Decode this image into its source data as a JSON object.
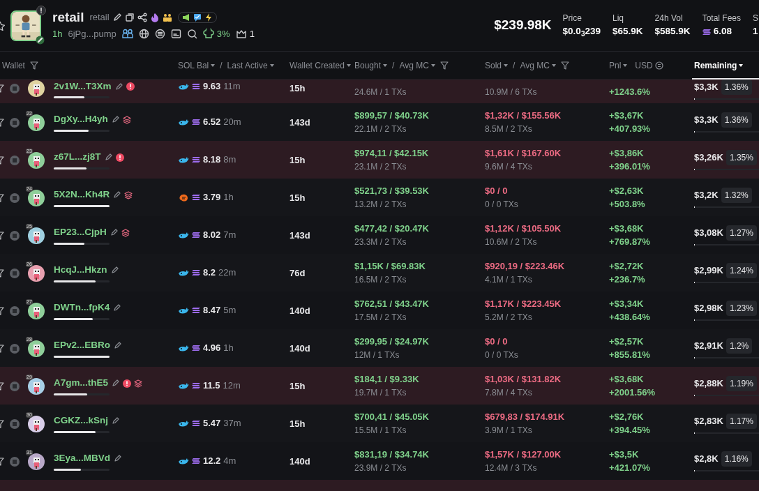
{
  "token": {
    "name": "retail",
    "ticker": "retail",
    "age": "1h",
    "address": "6jPg...pump",
    "chef_pct": "3%",
    "crown_count": "1"
  },
  "market_cap": "$239.98K",
  "stats": [
    {
      "label": "Price",
      "value": "$0.0$_{3}$239",
      "kind": "plain"
    },
    {
      "label": "Liq",
      "value": "$65.9K",
      "kind": "plain"
    },
    {
      "label": "24h Vol",
      "value": "$585.9K",
      "kind": "plain"
    },
    {
      "label": "Total Fees",
      "value": "6.08",
      "kind": "sol"
    },
    {
      "label": "S",
      "value": "1",
      "kind": "plain"
    }
  ],
  "columns": [
    {
      "labels": [
        {
          "text": "Wallet",
          "sortable": false
        }
      ],
      "filter": true,
      "selected": false
    },
    {
      "labels": [
        {
          "text": "SOL Bal",
          "sortable": true
        },
        {
          "text": "Last Active",
          "sortable": true
        }
      ],
      "separator": "/",
      "filter": false,
      "selected": false
    },
    {
      "labels": [
        {
          "text": "Wallet Created",
          "sortable": true
        }
      ],
      "filter": false,
      "selected": false
    },
    {
      "labels": [
        {
          "text": "Bought",
          "sortable": true
        },
        {
          "text": "Avg MC",
          "sortable": true
        }
      ],
      "separator": "/",
      "filter": true,
      "selected": false
    },
    {
      "labels": [
        {
          "text": "Sold",
          "sortable": true
        },
        {
          "text": "Avg MC",
          "sortable": true
        }
      ],
      "separator": "/",
      "filter": true,
      "selected": false
    },
    {
      "labels": [
        {
          "text": "Pnl",
          "sortable": true
        }
      ],
      "unit": "USD",
      "filter": false,
      "selected": false
    },
    {
      "labels": [
        {
          "text": "Remaining",
          "sortable": true
        }
      ],
      "filter": false,
      "selected": true
    }
  ],
  "rows": [
    {
      "partial": true,
      "flagged": true,
      "wallet": "2v1W...T3Xm",
      "warning": true,
      "bundled": false,
      "progress": {
        "level": 0.55
      },
      "holder": {
        "kind": "whale"
      },
      "sol_balance": "9.63",
      "last_active": "11m",
      "created": "15h",
      "bought": {
        "detail": "24.6M / 1 TXs"
      },
      "sold": {
        "detail": "10.9M / 6 TXs"
      },
      "pnl": {
        "pct": "+1243.6%"
      },
      "remaining": {
        "value": "$3,3K",
        "pct": "1.36%",
        "level": 0.01
      }
    },
    {
      "partial": false,
      "flagged": false,
      "rank": "22",
      "wallet": "DgXy...H4yh",
      "warning": false,
      "bundled": true,
      "progress": {
        "level": 0.62
      },
      "holder": {
        "kind": "whale"
      },
      "sol_balance": "6.52",
      "last_active": "20m",
      "created": "143d",
      "bought": {
        "value": "$899,57 / $40.73K",
        "detail": "22.1M / 2 TXs"
      },
      "sold": {
        "value": "$1,32K / $155.56K",
        "detail": "8.5M / 2 TXs"
      },
      "pnl": {
        "usd": "+$3,67K",
        "pct": "+407.93%"
      },
      "remaining": {
        "value": "$3,3K",
        "pct": "1.36%",
        "level": 0.01
      }
    },
    {
      "partial": false,
      "flagged": true,
      "rank": "23",
      "wallet": "z67L...zj8T",
      "warning": true,
      "bundled": false,
      "progress": {
        "level": 0.59
      },
      "holder": {
        "kind": "whale"
      },
      "sol_balance": "8.18",
      "last_active": "8m",
      "created": "15h",
      "bought": {
        "value": "$974,11 / $42.15K",
        "detail": "23.1M / 2 TXs"
      },
      "sold": {
        "value": "$1,61K / $167.60K",
        "detail": "9.6M / 4 TXs"
      },
      "pnl": {
        "usd": "+$3,86K",
        "pct": "+396.01%"
      },
      "remaining": {
        "value": "$3,26K",
        "pct": "1.35%",
        "level": 0.01
      }
    },
    {
      "partial": false,
      "flagged": false,
      "rank": "24",
      "wallet": "5X2N...Kh4R",
      "warning": false,
      "bundled": true,
      "progress": {
        "level": 1
      },
      "holder": {
        "kind": "shrimp"
      },
      "sol_balance": "3.79",
      "last_active": "1h",
      "created": "15h",
      "bought": {
        "value": "$521,73 / $39.53K",
        "detail": "13.2M / 2 TXs"
      },
      "sold": {
        "value": "$0 / 0",
        "detail": "0 / 0 TXs"
      },
      "pnl": {
        "usd": "+$2,63K",
        "pct": "+503.8%"
      },
      "remaining": {
        "value": "$3,2K",
        "pct": "1.32%",
        "level": 0.01
      }
    },
    {
      "partial": false,
      "flagged": false,
      "rank": "25",
      "wallet": "EP23...CjpH",
      "warning": false,
      "bundled": true,
      "progress": {
        "level": 0.55
      },
      "holder": {
        "kind": "whale"
      },
      "sol_balance": "8.02",
      "last_active": "7m",
      "created": "143d",
      "bought": {
        "value": "$477,42 / $20.47K",
        "detail": "23.3M / 2 TXs"
      },
      "sold": {
        "value": "$1,12K / $105.50K",
        "detail": "10.6M / 2 TXs"
      },
      "pnl": {
        "usd": "+$3,68K",
        "pct": "+769.87%"
      },
      "remaining": {
        "value": "$3,08K",
        "pct": "1.27%",
        "level": 0.01
      }
    },
    {
      "partial": false,
      "flagged": false,
      "rank": "26",
      "wallet": "HcqJ...Hkzn",
      "warning": false,
      "bundled": false,
      "progress": {
        "level": 0.75
      },
      "holder": {
        "kind": "whale"
      },
      "sol_balance": "8.2",
      "last_active": "22m",
      "created": "76d",
      "bought": {
        "value": "$1,15K / $69.83K",
        "detail": "16.5M / 2 TXs"
      },
      "sold": {
        "value": "$920,19 / $223.46K",
        "detail": "4.1M / 1 TXs"
      },
      "pnl": {
        "usd": "+$2,72K",
        "pct": "+236.7%"
      },
      "remaining": {
        "value": "$2,99K",
        "pct": "1.24%",
        "level": 0.01
      }
    },
    {
      "partial": false,
      "flagged": false,
      "rank": "27",
      "wallet": "DWTn...fpK4",
      "warning": false,
      "bundled": false,
      "progress": {
        "level": 0.7
      },
      "holder": {
        "kind": "whale"
      },
      "sol_balance": "8.47",
      "last_active": "5m",
      "created": "140d",
      "bought": {
        "value": "$762,51 / $43.47K",
        "detail": "17.5M / 2 TXs"
      },
      "sold": {
        "value": "$1,17K / $223.45K",
        "detail": "5.2M / 2 TXs"
      },
      "pnl": {
        "usd": "+$3,34K",
        "pct": "+438.64%"
      },
      "remaining": {
        "value": "$2,98K",
        "pct": "1.23%",
        "level": 0.01
      }
    },
    {
      "partial": false,
      "flagged": false,
      "rank": "28",
      "wallet": "EPv2...EBRo",
      "warning": false,
      "bundled": false,
      "progress": {
        "level": 1
      },
      "holder": {
        "kind": "whale"
      },
      "sol_balance": "4.96",
      "last_active": "1h",
      "created": "140d",
      "bought": {
        "value": "$299,95 / $24.97K",
        "detail": "12M / 1 TXs"
      },
      "sold": {
        "value": "$0 / 0",
        "detail": "0 / 0 TXs"
      },
      "pnl": {
        "usd": "+$2,57K",
        "pct": "+855.81%"
      },
      "remaining": {
        "value": "$2,91K",
        "pct": "1.2%",
        "level": 0.01
      }
    },
    {
      "partial": false,
      "flagged": true,
      "rank": "29",
      "wallet": "A7gm...thE5",
      "warning": true,
      "bundled": true,
      "progress": {
        "level": 0.6
      },
      "holder": {
        "kind": "whale"
      },
      "sol_balance": "11.5",
      "last_active": "12m",
      "created": "15h",
      "bought": {
        "value": "$184,1 / $9.33K",
        "detail": "19.7M / 1 TXs"
      },
      "sold": {
        "value": "$1,03K / $131.82K",
        "detail": "7.8M / 4 TXs"
      },
      "pnl": {
        "usd": "+$3,68K",
        "pct": "+2001.56%"
      },
      "remaining": {
        "value": "$2,88K",
        "pct": "1.19%",
        "level": 0.01
      }
    },
    {
      "partial": false,
      "flagged": false,
      "rank": "30",
      "wallet": "CGKZ...kSnj",
      "warning": false,
      "bundled": false,
      "progress": {
        "level": 0.75
      },
      "holder": {
        "kind": "whale"
      },
      "sol_balance": "5.47",
      "last_active": "37m",
      "created": "15h",
      "bought": {
        "value": "$700,41 / $45.05K",
        "detail": "15.5M / 1 TXs"
      },
      "sold": {
        "value": "$679,83 / $174.91K",
        "detail": "3.9M / 1 TXs"
      },
      "pnl": {
        "usd": "+$2,76K",
        "pct": "+394.45%"
      },
      "remaining": {
        "value": "$2,83K",
        "pct": "1.17%",
        "level": 0.01
      }
    },
    {
      "partial": false,
      "flagged": false,
      "rank": "31",
      "wallet": "3Eya...MBVd",
      "warning": false,
      "bundled": false,
      "progress": {
        "level": 0.49
      },
      "holder": {
        "kind": "whale"
      },
      "sol_balance": "12.2",
      "last_active": "4m",
      "created": "140d",
      "bought": {
        "value": "$831,19 / $34.74K",
        "detail": "23.9M / 2 TXs"
      },
      "sold": {
        "value": "$1,57K / $127.00K",
        "detail": "12.4M / 3 TXs"
      },
      "pnl": {
        "usd": "+$3,5K",
        "pct": "+421.07%"
      },
      "remaining": {
        "value": "$2,8K",
        "pct": "1.16%",
        "level": 0.01
      }
    },
    {
      "partial": true,
      "flagged": true
    }
  ]
}
